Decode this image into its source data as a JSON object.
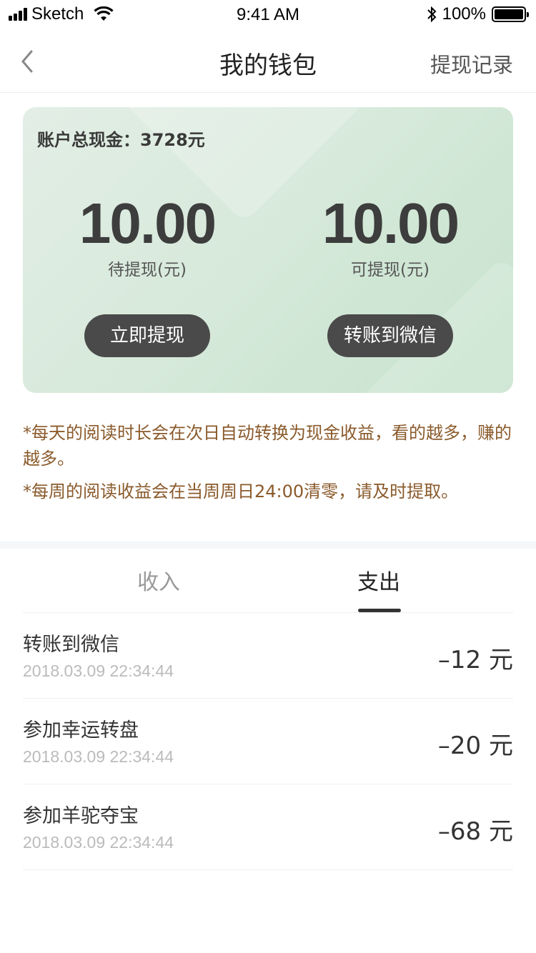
{
  "status_bar": {
    "carrier": "Sketch",
    "time": "9:41 AM",
    "battery": "100%",
    "battery_level": 1.0
  },
  "nav": {
    "title": "我的钱包",
    "right_action": "提现记录"
  },
  "card": {
    "total": "账户总现金：3728元",
    "pending_amount": "10.00",
    "pending_label": "待提现(元)",
    "available_amount": "10.00",
    "available_label": "可提现(元)",
    "withdraw_button": "立即提现",
    "wechat_button": "转账到微信"
  },
  "notes": {
    "line1": "*每天的阅读时长会在次日自动转换为现金收益，看的越多，赚的越多。",
    "line2": "*每周的阅读收益会在当周周日24:00清零，请及时提取。"
  },
  "tabs": {
    "income": "收入",
    "expense": "支出",
    "active": "expense"
  },
  "transactions": [
    {
      "title": "转账到微信",
      "time": "2018.03.09   22:34:44",
      "amount": "–12 元"
    },
    {
      "title": "参加幸运转盘",
      "time": "2018.03.09   22:34:44",
      "amount": "–20 元"
    },
    {
      "title": "参加羊驼夺宝",
      "time": "2018.03.09   22:34:44",
      "amount": "–68 元"
    }
  ]
}
